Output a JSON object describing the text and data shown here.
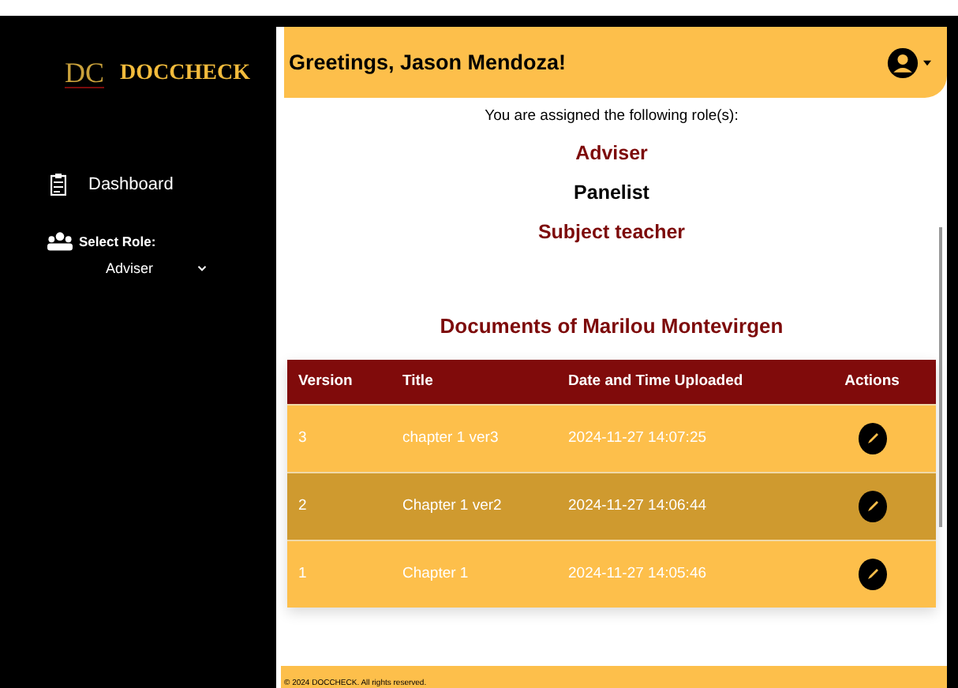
{
  "sidebar": {
    "logo_mark": "DC",
    "brand": "DOCCHECK",
    "items": [
      {
        "label": "Dashboard"
      }
    ],
    "role_select": {
      "label": "Select Role:",
      "value": "Adviser"
    }
  },
  "header": {
    "greeting": "Greetings, Jason Mendoza!"
  },
  "roles": {
    "intro": "You are assigned the following role(s):",
    "items": [
      {
        "label": "Adviser",
        "selected": true
      },
      {
        "label": "Panelist",
        "selected": false
      },
      {
        "label": "Subject teacher",
        "selected": true
      }
    ]
  },
  "documents": {
    "title": "Documents of Marilou Montevirgen",
    "columns": [
      "Version",
      "Title",
      "Date and Time Uploaded",
      "Actions"
    ],
    "rows": [
      {
        "version": "3",
        "title": "chapter 1 ver3",
        "uploaded": "2024-11-27 14:07:25",
        "selected": false
      },
      {
        "version": "2",
        "title": "Chapter 1 ver2",
        "uploaded": "2024-11-27 14:06:44",
        "selected": true
      },
      {
        "version": "1",
        "title": "Chapter 1",
        "uploaded": "2024-11-27 14:05:46",
        "selected": false
      }
    ]
  },
  "footer": {
    "text": "© 2024 DOCCHECK. All rights reserved."
  }
}
